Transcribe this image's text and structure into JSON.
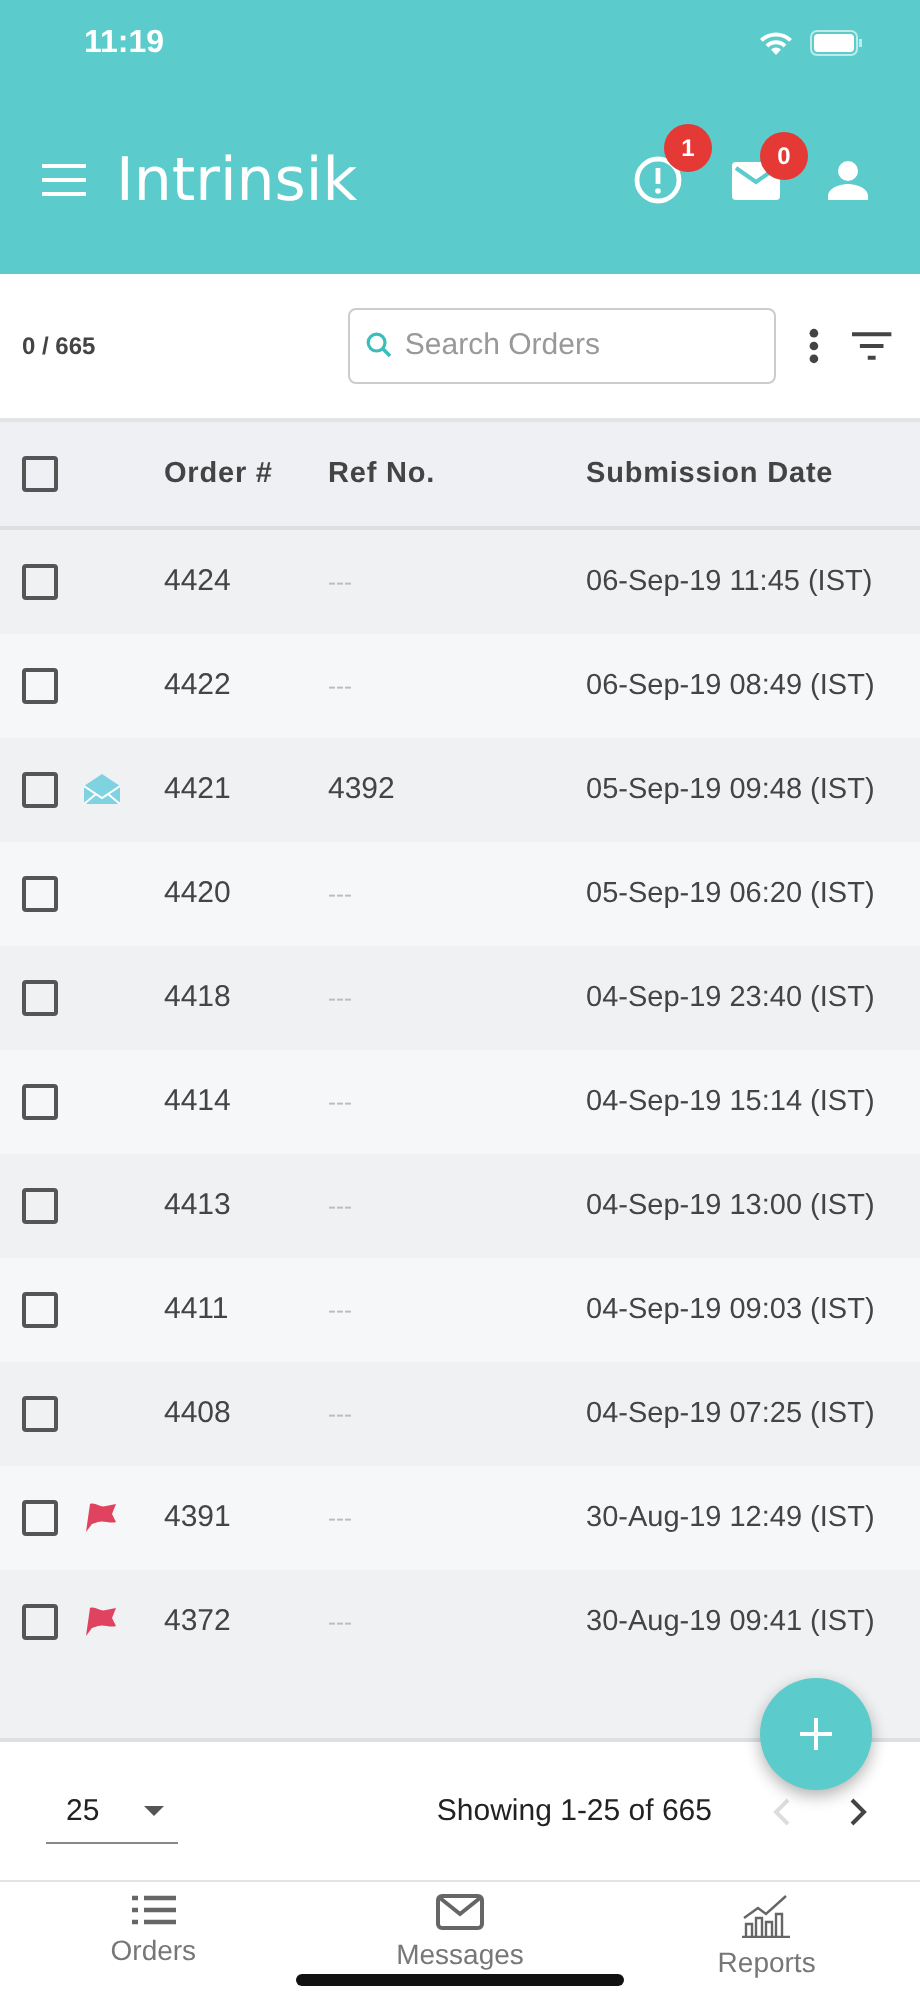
{
  "status_bar": {
    "time": "11:19"
  },
  "app_bar": {
    "title": "Intrinsik",
    "alerts_badge": "1",
    "messages_badge": "0"
  },
  "toolbar": {
    "selection_count": "0 / 665",
    "search": {
      "placeholder": "Search Orders"
    }
  },
  "table": {
    "header_checked": false,
    "columns": [
      "Order #",
      "Ref No.",
      "Submission Date"
    ],
    "rows": [
      {
        "checked": false,
        "kind": "plain",
        "order": "4424",
        "ref": "---",
        "date": "06-Sep-19 11:45 (IST)"
      },
      {
        "checked": false,
        "kind": "plain",
        "order": "4422",
        "ref": "---",
        "date": "06-Sep-19 08:49 (IST)"
      },
      {
        "checked": false,
        "kind": "mail",
        "order": "4421",
        "ref": "4392",
        "date": "05-Sep-19 09:48 (IST)"
      },
      {
        "checked": false,
        "kind": "plain",
        "order": "4420",
        "ref": "---",
        "date": "05-Sep-19 06:20 (IST)"
      },
      {
        "checked": false,
        "kind": "plain",
        "order": "4418",
        "ref": "---",
        "date": "04-Sep-19 23:40 (IST)"
      },
      {
        "checked": false,
        "kind": "plain",
        "order": "4414",
        "ref": "---",
        "date": "04-Sep-19 15:14 (IST)"
      },
      {
        "checked": false,
        "kind": "plain",
        "order": "4413",
        "ref": "---",
        "date": "04-Sep-19 13:00 (IST)"
      },
      {
        "checked": false,
        "kind": "plain",
        "order": "4411",
        "ref": "---",
        "date": "04-Sep-19 09:03 (IST)"
      },
      {
        "checked": false,
        "kind": "plain",
        "order": "4408",
        "ref": "---",
        "date": "04-Sep-19 07:25 (IST)"
      },
      {
        "checked": false,
        "kind": "flag",
        "order": "4391",
        "ref": "---",
        "date": "30-Aug-19 12:49 (IST)"
      },
      {
        "checked": false,
        "kind": "flag",
        "order": "4372",
        "ref": "---",
        "date": "30-Aug-19 09:41 (IST)"
      }
    ]
  },
  "pagination": {
    "page_size": "25",
    "summary": "Showing 1-25 of 665",
    "prev_enabled": false,
    "next_enabled": true
  },
  "tab_bar": [
    {
      "kind": "orders",
      "label": "Orders"
    },
    {
      "kind": "messages",
      "label": "Messages"
    },
    {
      "kind": "reports",
      "label": "Reports"
    }
  ]
}
